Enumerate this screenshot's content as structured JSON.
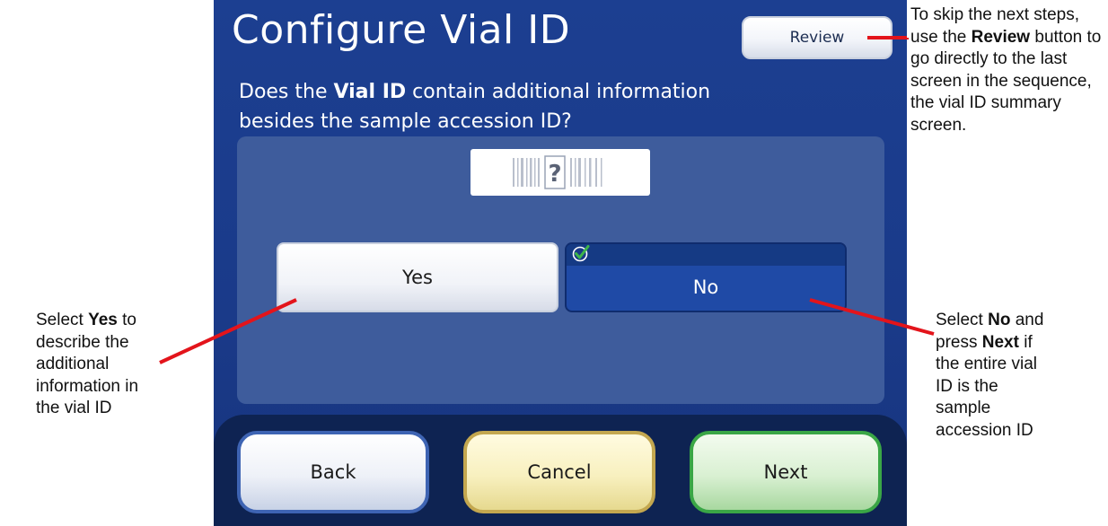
{
  "screen": {
    "title": "Configure Vial ID",
    "review_label": "Review",
    "question": {
      "part1": "Does the ",
      "bold": "Vial ID",
      "part2": " contain additional information besides the sample accession ID?"
    },
    "barcode_symbol": "?",
    "choices": {
      "yes_label": "Yes",
      "no_label": "No",
      "selected": "No"
    },
    "nav": {
      "back_label": "Back",
      "cancel_label": "Cancel",
      "next_label": "Next"
    }
  },
  "annotations": {
    "review_note": {
      "pre": "To skip the next steps, use the ",
      "bold": "Review",
      "post": " button to go directly to the last screen in the sequence, the vial ID summary screen."
    },
    "yes_note": {
      "pre": "Select ",
      "bold": "Yes",
      "post": " to describe the additional information in the vial ID"
    },
    "no_note": {
      "pre": "Select ",
      "bold1": "No",
      "mid": " and press ",
      "bold2": "Next",
      "post": " if the entire vial ID is the sample accession ID"
    }
  },
  "colors": {
    "screen_bg": "#1c3f91",
    "panel_bg": "#3e5c9c",
    "selected_bg": "#1f4aa6",
    "annotation_line": "#e3141b",
    "back_border": "#3e64b3",
    "cancel_border": "#c3a74f",
    "next_border": "#3aa646",
    "check_green": "#3db54a"
  }
}
